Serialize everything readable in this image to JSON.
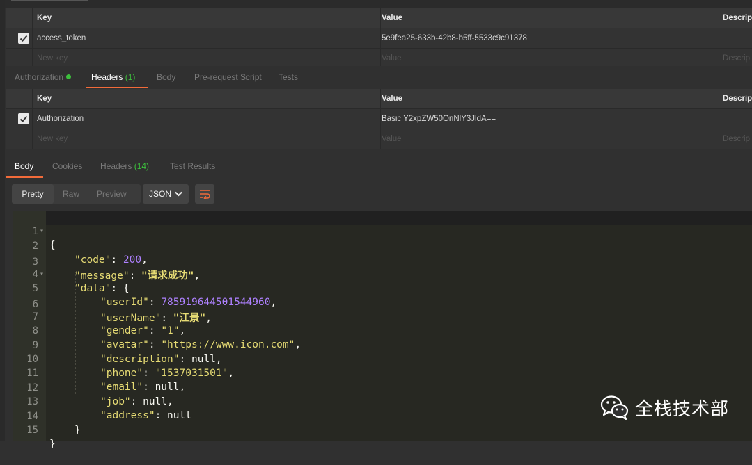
{
  "params_table": {
    "headers": {
      "key": "Key",
      "value": "Value",
      "description": "Descrip"
    },
    "rows": [
      {
        "key": "access_token",
        "value": "5e9fea25-633b-42b8-b5ff-5533c9c91378",
        "checked": true
      }
    ],
    "new_row": {
      "key_placeholder": "New key",
      "value_placeholder": "Value",
      "description_placeholder": "Descrip"
    }
  },
  "request_tabs": {
    "authorization": "Authorization",
    "headers": "Headers",
    "headers_count": "(1)",
    "body": "Body",
    "prerequest": "Pre-request Script",
    "tests": "Tests"
  },
  "headers_table": {
    "headers": {
      "key": "Key",
      "value": "Value",
      "description": "Descrip"
    },
    "rows": [
      {
        "key": "Authorization",
        "value": "Basic Y2xpZW50OnNlY3JldA==",
        "checked": true
      }
    ],
    "new_row": {
      "key_placeholder": "New key",
      "value_placeholder": "Value",
      "description_placeholder": "Descrip"
    }
  },
  "response_tabs": {
    "body": "Body",
    "cookies": "Cookies",
    "headers": "Headers",
    "headers_count": "(14)",
    "test_results": "Test Results"
  },
  "view_modes": {
    "pretty": "Pretty",
    "raw": "Raw",
    "preview": "Preview",
    "format": "JSON"
  },
  "response_code": {
    "line_numbers": [
      "1",
      "2",
      "3",
      "4",
      "5",
      "6",
      "7",
      "8",
      "9",
      "10",
      "11",
      "12",
      "13",
      "14",
      "15"
    ],
    "open_brace": "{",
    "close_brace": "}",
    "code_key": "\"code\"",
    "code_val": "200",
    "message_key": "\"message\"",
    "message_val": "\"请求成功\"",
    "data_key": "\"data\"",
    "userId_key": "\"userId\"",
    "userId_val": "785919644501544960",
    "userName_key": "\"userName\"",
    "userName_val": "\"江景\"",
    "gender_key": "\"gender\"",
    "gender_val": "\"1\"",
    "avatar_key": "\"avatar\"",
    "avatar_val": "\"https://www.icon.com\"",
    "description_key": "\"description\"",
    "phone_key": "\"phone\"",
    "phone_val": "\"1537031501\"",
    "email_key": "\"email\"",
    "job_key": "\"job\"",
    "address_key": "\"address\"",
    "null_val": "null"
  },
  "watermark": {
    "text": "全栈技术部",
    "icon": "wechat-icon"
  },
  "colors": {
    "accent": "#f26b3a",
    "green": "#3cbf3c",
    "editor_bg": "#272822"
  }
}
